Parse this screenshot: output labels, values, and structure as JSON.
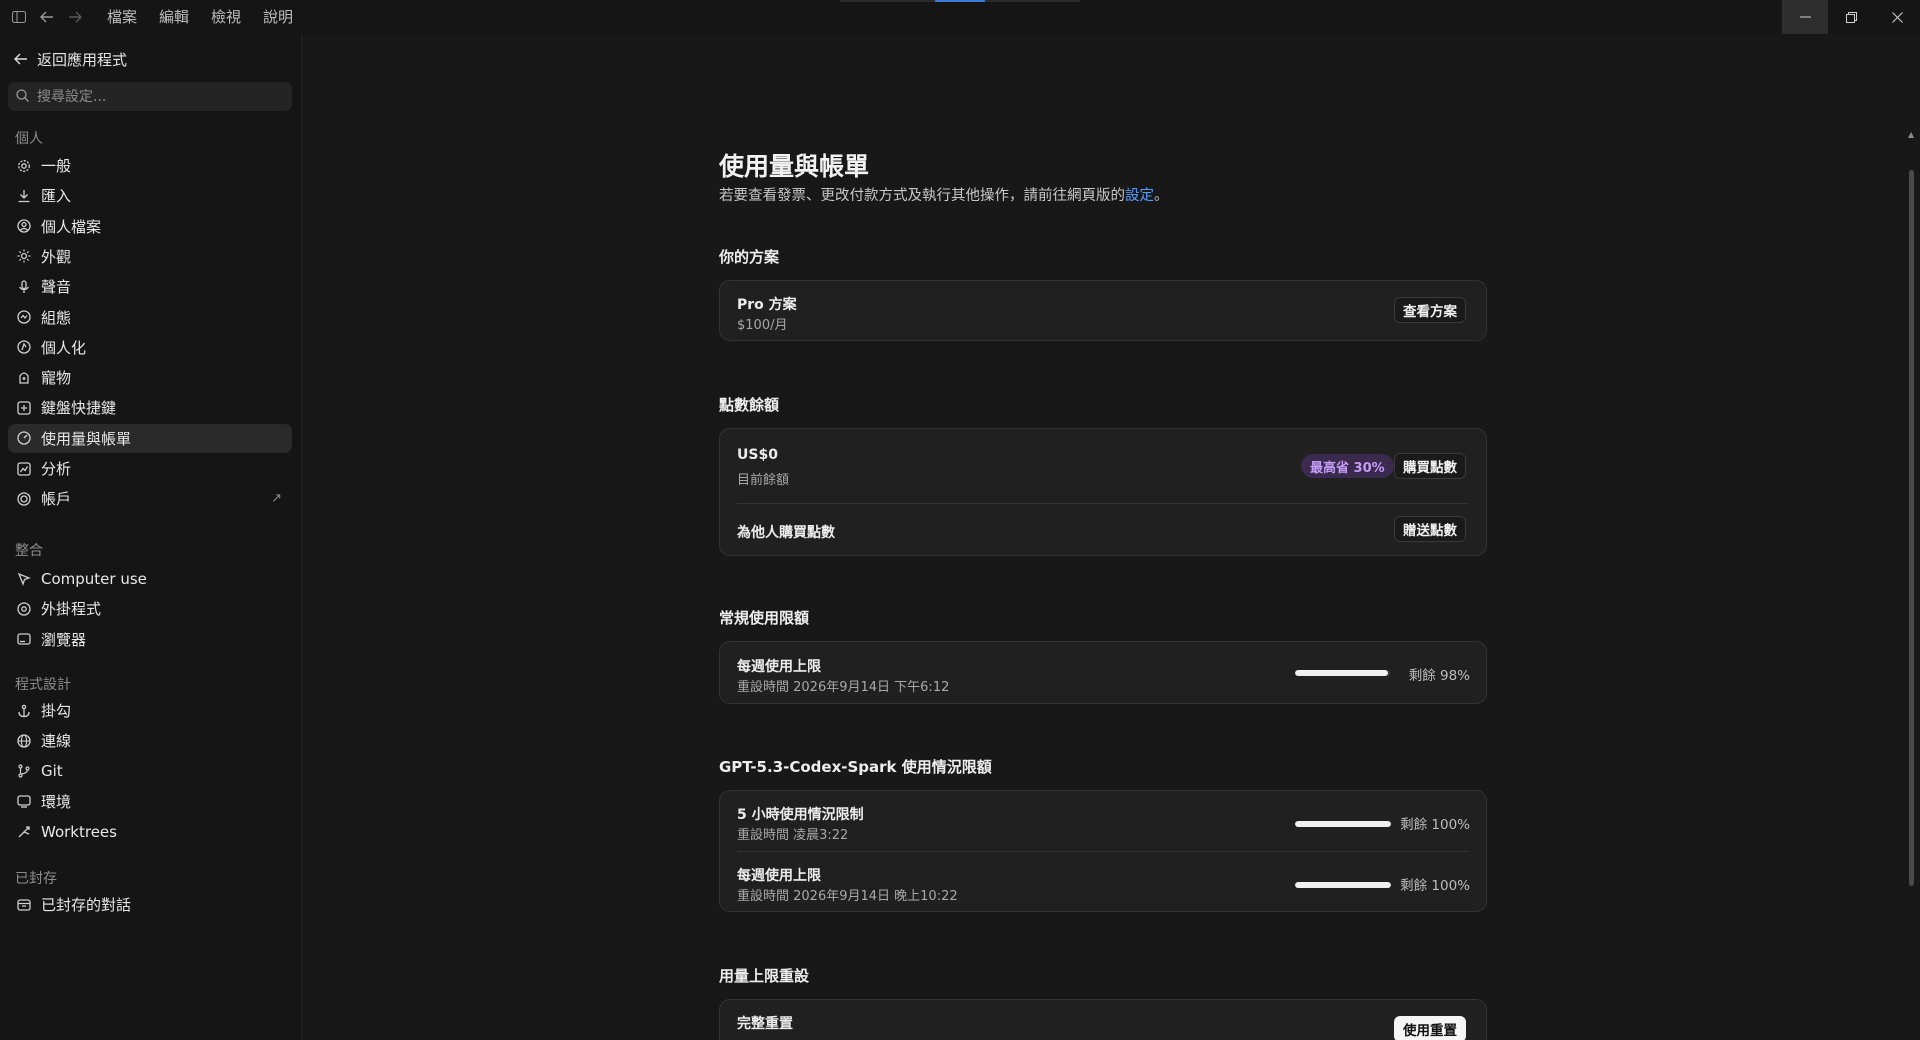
{
  "titlebar": {
    "menu": [
      "檔案",
      "編輯",
      "檢視",
      "說明"
    ]
  },
  "sidebar": {
    "back_label": "返回應用程式",
    "search_placeholder": "搜尋設定...",
    "sections": {
      "personal": "個人",
      "integrations": "整合",
      "programming": "程式設計",
      "archived": "已封存"
    },
    "personal_items": [
      {
        "label": "一般",
        "icon": "gear-icon"
      },
      {
        "label": "匯入",
        "icon": "download-icon"
      },
      {
        "label": "個人檔案",
        "icon": "user-circle-icon"
      },
      {
        "label": "外觀",
        "icon": "sun-icon"
      },
      {
        "label": "聲音",
        "icon": "microphone-icon"
      },
      {
        "label": "組態",
        "icon": "config-icon"
      },
      {
        "label": "個人化",
        "icon": "personalize-icon"
      },
      {
        "label": "寵物",
        "icon": "pet-icon"
      },
      {
        "label": "鍵盤快捷鍵",
        "icon": "keyboard-icon"
      },
      {
        "label": "使用量與帳單",
        "icon": "gauge-icon"
      },
      {
        "label": "分析",
        "icon": "chart-icon"
      },
      {
        "label": "帳戶",
        "icon": "account-icon"
      }
    ],
    "integration_items": [
      {
        "label": "Computer use",
        "icon": "cursor-icon"
      },
      {
        "label": "外掛程式",
        "icon": "plugin-icon"
      },
      {
        "label": "瀏覽器",
        "icon": "browser-icon"
      }
    ],
    "programming_items": [
      {
        "label": "掛勾",
        "icon": "anchor-icon"
      },
      {
        "label": "連線",
        "icon": "globe-icon"
      },
      {
        "label": "Git",
        "icon": "git-branch-icon"
      },
      {
        "label": "環境",
        "icon": "monitor-icon"
      },
      {
        "label": "Worktrees",
        "icon": "worktree-icon"
      }
    ],
    "archived_items": [
      {
        "label": "已封存的對話",
        "icon": "archive-icon"
      }
    ],
    "selected": "使用量與帳單"
  },
  "main": {
    "title": "使用量與帳單",
    "subtitle_text": "若要查看發票、更改付款方式及執行其他操作，請前往網頁版的",
    "subtitle_link": "設定",
    "subtitle_end": "。",
    "plan": {
      "section": "你的方案",
      "name": "Pro 方案",
      "price": "$100/月",
      "button": "查看方案"
    },
    "credits": {
      "section": "點數餘額",
      "amount": "US$0",
      "amount_label": "目前餘額",
      "badge": "最高省 30%",
      "buy_button": "購買點數",
      "gift_label": "為他人購買點數",
      "gift_button": "贈送點數"
    },
    "regular_limits": {
      "section": "常規使用限額",
      "weekly_title": "每週使用上限",
      "weekly_reset": "重設時間 2026年9月14日 下午6:12",
      "weekly_remaining": "剩餘 98%",
      "weekly_fraction": 0.98
    },
    "spark_limits": {
      "section": "GPT-5.3-Codex-Spark 使用情況限額",
      "five_hour_title": "5 小時使用情況限制",
      "five_hour_reset": "重設時間 凌晨3:22",
      "five_hour_remaining": "剩餘 100%",
      "five_hour_fraction": 1.0,
      "weekly_title": "每週使用上限",
      "weekly_reset": "重設時間 2026年9月14日 晚上10:22",
      "weekly_remaining": "剩餘 100%",
      "weekly_fraction": 1.0
    },
    "reset": {
      "section": "用量上限重設",
      "full_title": "完整重置",
      "button": "使用重置"
    }
  }
}
